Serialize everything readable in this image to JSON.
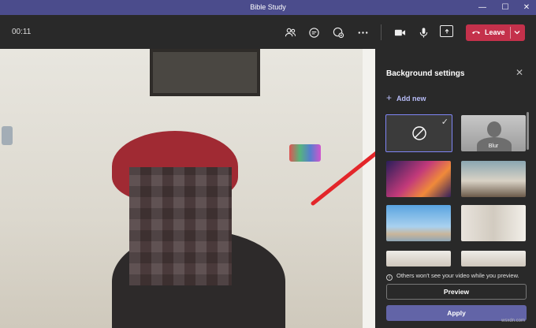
{
  "window": {
    "title": "Bible Study",
    "minimize": "—",
    "maximize": "☐",
    "close": "✕"
  },
  "toolbar": {
    "timer": "00:11",
    "leave_label": "Leave"
  },
  "panel": {
    "title": "Background settings",
    "add_new": "Add new",
    "tiles": [
      {
        "id": "none",
        "selected": true
      },
      {
        "id": "blur",
        "label": "Blur"
      },
      {
        "id": "galaxy"
      },
      {
        "id": "office"
      },
      {
        "id": "beach"
      },
      {
        "id": "room"
      },
      {
        "id": "room-2"
      },
      {
        "id": "room-3"
      }
    ],
    "notice": "Others won't see your video while you preview.",
    "preview_label": "Preview",
    "apply_label": "Apply"
  },
  "watermark": "wsxdn.com",
  "colors": {
    "titlebar": "#4b4c8c",
    "leave": "#c4314b",
    "accent": "#6264a7",
    "arrow": "#e3262a"
  }
}
